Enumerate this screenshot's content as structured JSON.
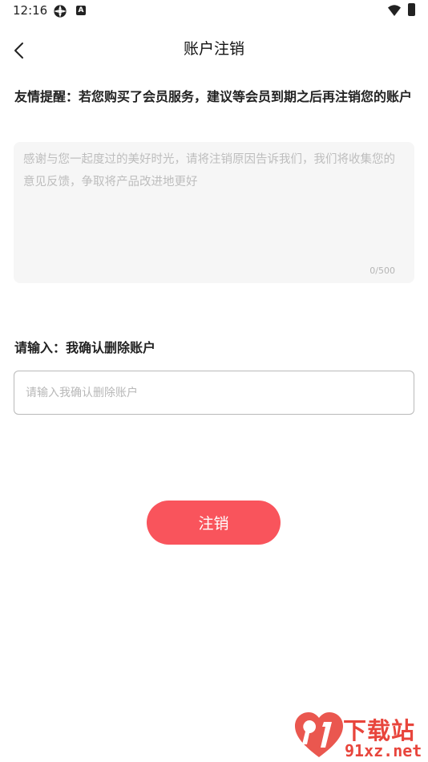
{
  "status_bar": {
    "time": "12:16",
    "a_badge": "A"
  },
  "nav": {
    "title": "账户注销"
  },
  "tip": "友情提醒：若您购买了会员服务，建议等会员到期之后再注销您的账户",
  "reason": {
    "placeholder": "感谢与您一起度过的美好时光，请将注销原因告诉我们，我们将收集您的意见反馈，争取将产品改进地更好",
    "value": "",
    "counter": "0/500"
  },
  "confirm": {
    "label": "请输入：我确认删除账户",
    "placeholder": "请输入我确认删除账户",
    "value": ""
  },
  "submit_label": "注销",
  "watermark": {
    "title": "下载站",
    "url": "91xz.net"
  },
  "colors": {
    "accent": "#f9545c",
    "input_border": "#b9b9b9",
    "reason_bg": "#f6f6f6",
    "watermark": "#e8453c"
  }
}
